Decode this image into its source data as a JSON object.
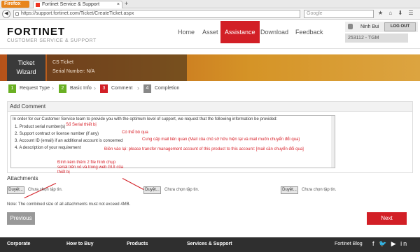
{
  "browser": {
    "menu_label": "Firefox",
    "tab_title": "Fortinet Service & Support",
    "url": "https://support.fortinet.com/Ticket/CreateTicket.aspx",
    "search_placeholder": "Google"
  },
  "header": {
    "logo": "FORTINET",
    "logo_sub": "CUSTOMER SERVICE & SUPPORT",
    "nav": [
      "Home",
      "Asset",
      "Assistance",
      "Download",
      "Feedback"
    ],
    "user": "Ninh Bui",
    "logout": "LOG OUT",
    "account": "253112 - TGM"
  },
  "wizard": {
    "title_1": "Ticket",
    "title_2": "Wizard",
    "ticket_type": "CS Ticket",
    "serial": "Serial Number: N/A"
  },
  "steps": [
    {
      "n": "1",
      "label": "Request Type"
    },
    {
      "n": "2",
      "label": "Basic Info"
    },
    {
      "n": "3",
      "label": "Comment"
    },
    {
      "n": "4",
      "label": "Completion"
    }
  ],
  "comment": {
    "title": "Add Comment",
    "intro": "In order for our Customer Service team to provide you with the optimum level of support, we request that the following information be provided:",
    "items": [
      "1. Product serial number(s)",
      "2. Support contract or license number (if any)",
      "3. Account ID (email) if an additional account is concerned",
      "4. A description of your requirement"
    ],
    "notes": [
      "Số Serial thiết bị",
      "Có thể bỏ qua",
      "Cung cấp mail liên quan (Mail của chủ sở hữu hiện tại và mail muốn chuyển đổi qua)",
      "Điền vào lại: please transfer management account of this product to this account: [mail cần chuyển đổi qua]"
    ]
  },
  "attachments": {
    "title": "Attachments",
    "browse": "Duyệt...",
    "no_file": "Chưa chọn tập tin.",
    "note": "Đính kèm thêm 2 file hình chụp serial trên vỏ và trong web GUI của thiết bị",
    "note_lines": [
      "Đính kèm thêm 2 file hình chụp",
      "serial trên vỏ và trong web GUI của",
      "thiết bị"
    ],
    "combined": "Note: The combined size of all attachments must not exceed 4MB."
  },
  "buttons": {
    "previous": "Previous",
    "next": "Next"
  },
  "footer": {
    "items": [
      "Corporate",
      "How to Buy",
      "Products",
      "Services & Support"
    ],
    "blog": "Fortinet Blog"
  },
  "colors": {
    "accent": "#d21f26",
    "step_done": "#6ab023",
    "step_active": "#d21f26",
    "step_pending": "#888888"
  }
}
